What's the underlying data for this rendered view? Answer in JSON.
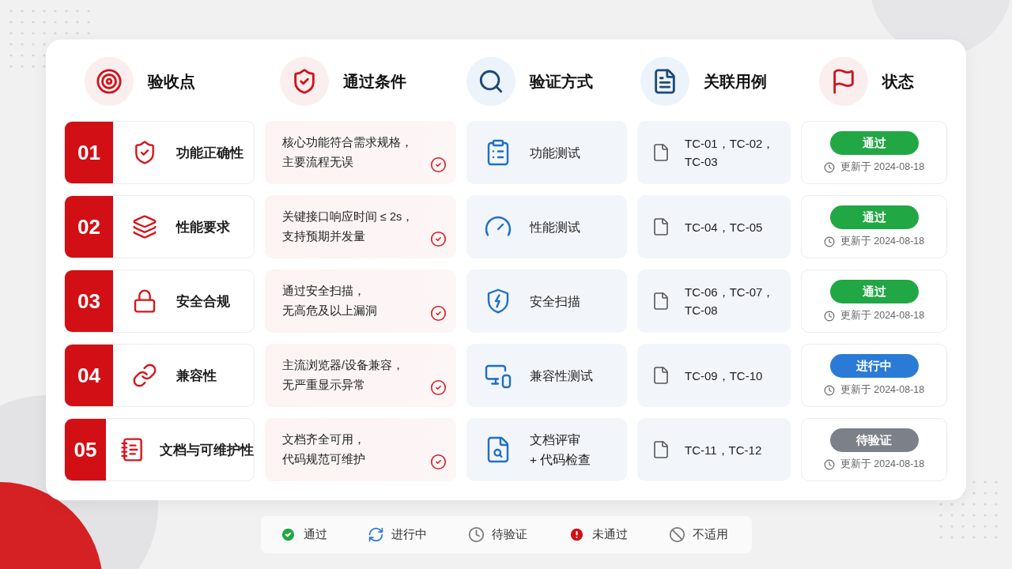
{
  "headers": [
    {
      "label": "验收点"
    },
    {
      "label": "通过条件"
    },
    {
      "label": "验证方式"
    },
    {
      "label": "关联用例"
    },
    {
      "label": "状态"
    }
  ],
  "rows": [
    {
      "number": "01",
      "name": "功能正确性",
      "condition": [
        "核心功能符合需求规格，",
        "主要流程无误"
      ],
      "met": true,
      "method": "功能测试",
      "cases": "TC-01，TC-02，\nTC-03",
      "status": {
        "label": "通过",
        "kind": "pass"
      },
      "updated": "更新于 2024-08-18"
    },
    {
      "number": "02",
      "name": "性能要求",
      "condition": [
        "关键接口响应时间 ≤ 2s，",
        "支持预期并发量"
      ],
      "met": true,
      "method": "性能测试",
      "cases": "TC-04，TC-05",
      "status": {
        "label": "通过",
        "kind": "pass"
      },
      "updated": "更新于 2024-08-18"
    },
    {
      "number": "03",
      "name": "安全合规",
      "condition": [
        "通过安全扫描，",
        "无高危及以上漏洞"
      ],
      "met": true,
      "method": "安全扫描",
      "cases": "TC-06，TC-07，\nTC-08",
      "status": {
        "label": "通过",
        "kind": "pass"
      },
      "updated": "更新于 2024-08-18"
    },
    {
      "number": "04",
      "name": "兼容性",
      "condition": [
        "主流浏览器/设备兼容，",
        "无严重显示异常"
      ],
      "met": true,
      "method": "兼容性测试",
      "cases": "TC-09，TC-10",
      "status": {
        "label": "进行中",
        "kind": "progress"
      },
      "updated": "更新于 2024-08-18"
    },
    {
      "number": "05",
      "name": "文档与可维护性",
      "condition": [
        "文档齐全可用，",
        "代码规范可维护"
      ],
      "met": true,
      "method": "文档评审\n+ 代码检查",
      "cases": "TC-11，TC-12",
      "status": {
        "label": "待验证",
        "kind": "pending"
      },
      "updated": "更新于 2024-08-18"
    }
  ],
  "legend": [
    {
      "label": "通过",
      "kind": "pass"
    },
    {
      "label": "进行中",
      "kind": "progress"
    },
    {
      "label": "待验证",
      "kind": "pending"
    },
    {
      "label": "未通过",
      "kind": "fail"
    },
    {
      "label": "不适用",
      "kind": "na"
    }
  ]
}
